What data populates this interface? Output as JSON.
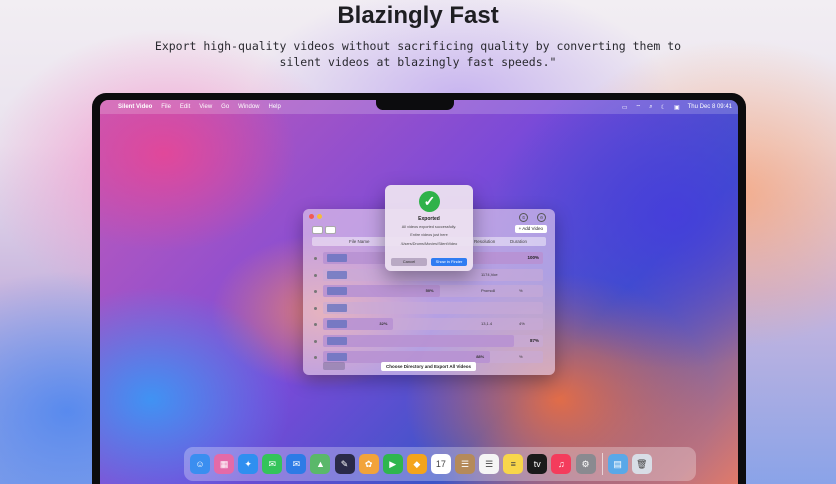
{
  "headline": "Blazingly Fast",
  "subline": "Export high-quality videos without sacrificing quality by converting them to silent videos at blazingly fast speeds.\"",
  "menubar": {
    "apple": "",
    "app_name": "Silent Video",
    "items": [
      "File",
      "Edit",
      "View",
      "Go",
      "Window",
      "Help"
    ],
    "status_icons": [
      "▭",
      "⌔",
      "⌕",
      "☾",
      "▣"
    ],
    "clock": "Thu Dec 8  09:41"
  },
  "app": {
    "add_button": "+ Add Video",
    "columns": [
      "File Name",
      "Resolution",
      "Duration"
    ],
    "rows": [
      {
        "pct": "100%",
        "fill": 1.0,
        "mid": "",
        "right": ""
      },
      {
        "pct": "",
        "fill": 0.0,
        "mid": "1174,Voe",
        "right": ""
      },
      {
        "pct": "",
        "fill": 0.53,
        "left": "50%",
        "mid": "Promo8",
        "right": "%"
      },
      {
        "pct": "",
        "fill": 0.0,
        "mid": "",
        "right": ""
      },
      {
        "pct": "",
        "fill": 0.32,
        "left": "32%",
        "mid": "13,1.4",
        "right": "4%"
      },
      {
        "pct": "87%",
        "fill": 0.87,
        "mid": "",
        "right": ""
      },
      {
        "pct": "",
        "fill": 0.76,
        "left": "88%",
        "mid": "",
        "right": "%"
      }
    ],
    "export_all_button": "Choose Directory and Export All Videos"
  },
  "dialog": {
    "icon": "✓",
    "title": "Exported",
    "line1": "All videos exported successfully.",
    "line2": "Entire videos just here",
    "line3": "/Users/Drums/Movies/SilentVideo",
    "cancel": "Cancel",
    "show": "Show in Finder"
  },
  "dock": [
    {
      "name": "finder",
      "glyph": "☺",
      "color": "#3a8ef0"
    },
    {
      "name": "launchpad",
      "glyph": "▦",
      "color": "#e46aa8"
    },
    {
      "name": "safari",
      "glyph": "✦",
      "color": "#2f8ff0"
    },
    {
      "name": "messages",
      "glyph": "✉",
      "color": "#34c45a"
    },
    {
      "name": "mail",
      "glyph": "✉",
      "color": "#2d7be6"
    },
    {
      "name": "maps",
      "glyph": "▲",
      "color": "#5ab86a"
    },
    {
      "name": "photo-editor",
      "glyph": "✎",
      "color": "#2a2a48"
    },
    {
      "name": "photos",
      "glyph": "✿",
      "color": "#f2a33a"
    },
    {
      "name": "facetime",
      "glyph": "▶",
      "color": "#2fb64e"
    },
    {
      "name": "sketch",
      "glyph": "◆",
      "color": "#f4a41c"
    },
    {
      "name": "calendar",
      "glyph": "17",
      "color": "#ffffff"
    },
    {
      "name": "contacts",
      "glyph": "☰",
      "color": "#b58a5a"
    },
    {
      "name": "reminders",
      "glyph": "☰",
      "color": "#f5f5f5"
    },
    {
      "name": "notes",
      "glyph": "≡",
      "color": "#f8d64a"
    },
    {
      "name": "apple-tv",
      "glyph": "tv",
      "color": "#1a1a1a"
    },
    {
      "name": "music",
      "glyph": "♫",
      "color": "#f43c5c"
    },
    {
      "name": "system-settings",
      "glyph": "⚙",
      "color": "#8a8a90"
    },
    {
      "name": "downloads-folder",
      "glyph": "▤",
      "color": "#5aa8e8"
    },
    {
      "name": "trash",
      "glyph": "🗑",
      "color": "#d8dde6"
    }
  ]
}
